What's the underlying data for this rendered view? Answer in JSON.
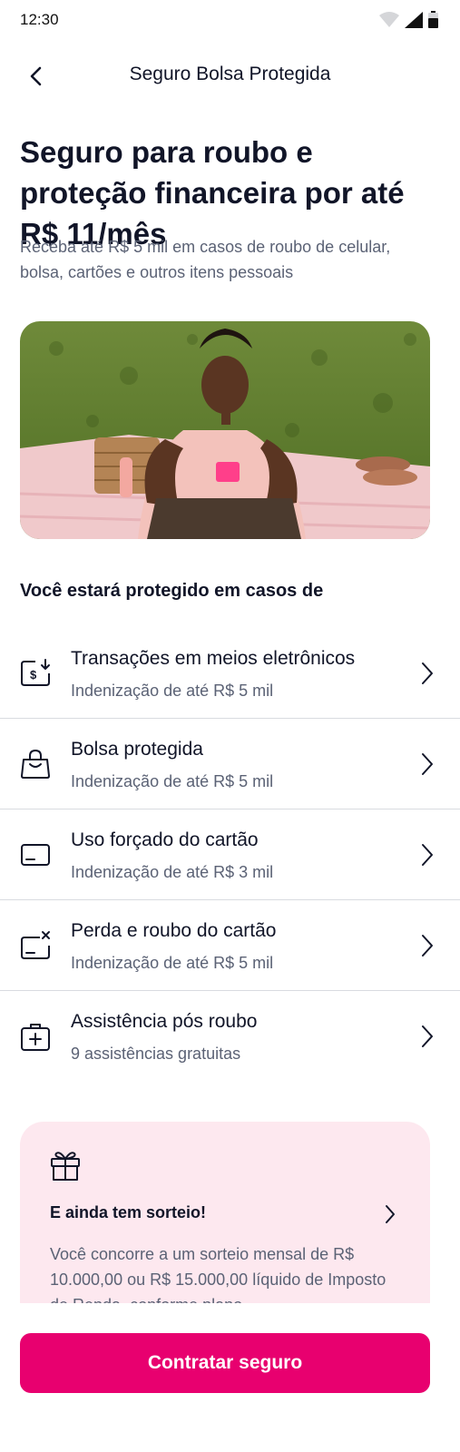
{
  "status_bar": {
    "time": "12:30"
  },
  "header": {
    "title": "Seguro Bolsa Protegida",
    "back_icon": "chevron-left-icon"
  },
  "hero": {
    "title": "Seguro para roubo e proteção financeira por até R$ 11/mês",
    "subtitle": "Receba até R$ 5 mil em casos de roubo de celular, bolsa, cartões e outros itens pessoais",
    "image": "man-sitting-on-picnic-blanket-with-phone"
  },
  "coverage": {
    "section_title": "Você estará protegido em casos de",
    "items": [
      {
        "title": "Transações em meios eletrônicos",
        "subtitle": "Indenização de até R$ 5 mil",
        "icon": "electronic-transaction-icon"
      },
      {
        "title": "Bolsa protegida",
        "subtitle": "Indenização de até R$ 5 mil",
        "icon": "bag-icon"
      },
      {
        "title": "Uso forçado do cartão",
        "subtitle": "Indenização de até R$ 3 mil",
        "icon": "card-icon"
      },
      {
        "title": "Perda e roubo do cartão",
        "subtitle": "Indenização de até R$ 5 mil",
        "icon": "card-lost-icon"
      },
      {
        "title": "Assistência pós roubo",
        "subtitle": "9 assistências gratuitas",
        "icon": "medical-kit-icon"
      }
    ]
  },
  "raffle": {
    "icon": "gift-icon",
    "title": "E ainda tem sorteio!",
    "text": "Você concorre a um sorteio mensal de R$ 10.000,00 ou R$ 15.000,00 líquido de Imposto de Renda, conforme plano"
  },
  "cta": {
    "label": "Contratar seguro"
  },
  "colors": {
    "brand": "#e8006f",
    "raffle_bg": "#fde8ef",
    "text_primary": "#111528",
    "text_secondary": "#5b6275"
  }
}
